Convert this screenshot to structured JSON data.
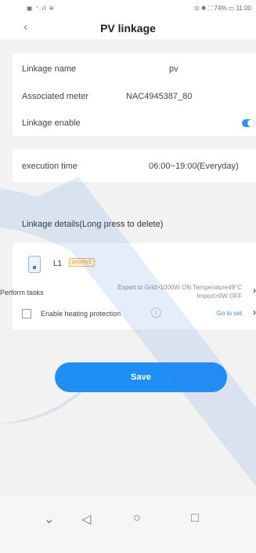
{
  "status": {
    "left": "▣ ᐩ.ıl ≋",
    "right": "⊙ ✱ ⛶ 74% ▭ 11:00"
  },
  "header": {
    "title": "PV linkage",
    "back_icon": "chevron-left-icon"
  },
  "form": {
    "linkage_name_label": "Linkage name",
    "linkage_name_value": "pv",
    "meter_label": "Associated meter",
    "meter_value": "NAC4945387_80",
    "enable_label": "Linkage enable",
    "enable_on": true,
    "execution_label": "execution time",
    "execution_value": "06:00~19:00(Everyday)"
  },
  "details": {
    "title": "Linkage details(Long press to delete)",
    "device_name": "L1",
    "priority": "priority1",
    "perform_label": "Perform tasks",
    "perform_line1": "Export to Grid>1000W ON Temperature49°C",
    "perform_line2": "Import>0W OFF",
    "heat_label": "Enable heating protection",
    "goto_label": "Go to set"
  },
  "save_label": "Save",
  "colors": {
    "accent": "#1f8ff6",
    "priority": "#e79a2a"
  }
}
